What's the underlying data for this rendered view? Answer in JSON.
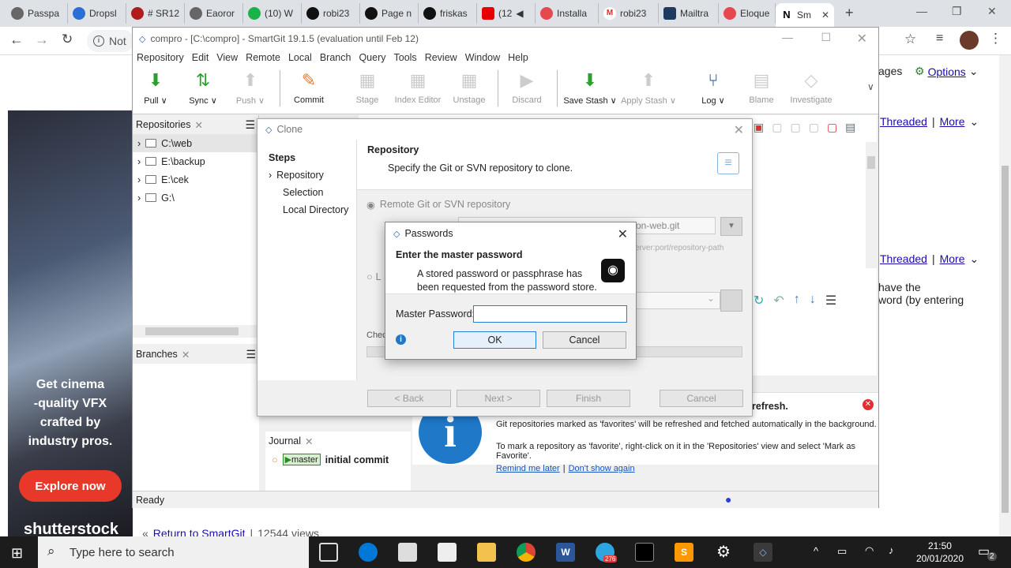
{
  "browser": {
    "tabs": [
      {
        "label": "Passpa",
        "color": "#555"
      },
      {
        "label": "Dropsl",
        "color": "#2a6fd6"
      },
      {
        "label": "# SR12",
        "color": "#b01c1c"
      },
      {
        "label": "Eaoror",
        "color": "#555"
      },
      {
        "label": "(10) W",
        "color": "#19b34a"
      },
      {
        "label": "robi23",
        "color": "#111"
      },
      {
        "label": "Page n",
        "color": "#111"
      },
      {
        "label": "friskas",
        "color": "#111"
      },
      {
        "label": "(12",
        "color": "#e60000"
      },
      {
        "label": "Installa",
        "color": "#e5484d"
      },
      {
        "label": "robi23",
        "color": "#d93025"
      },
      {
        "label": "Mailtra",
        "color": "#1e3a5f"
      },
      {
        "label": "Eloque",
        "color": "#e5484d"
      },
      {
        "label": "Sm",
        "color": "#111",
        "active": true
      }
    ],
    "not_secure": "Not",
    "new_tab": "+"
  },
  "webpage": {
    "ages": "ages",
    "options": "Options",
    "threaded": "Threaded",
    "more": "More",
    "have_the": "have the",
    "word_entering": "word (by entering",
    "ad_text": [
      "Get cinema",
      "-quality VFX",
      "crafted by",
      "industry pros."
    ],
    "explore": "Explore now",
    "shutterstock": "shutterstock",
    "return_link": "Return to SmartGit",
    "views": "12544 views",
    "return_prefix": "«",
    "sep": "|"
  },
  "smartgit": {
    "title": "compro - [C:\\compro] - SmartGit 19.1.5 (evaluation until Feb 12)",
    "menu": [
      "Repository",
      "Edit",
      "View",
      "Remote",
      "Local",
      "Branch",
      "Query",
      "Tools",
      "Review",
      "Window",
      "Help"
    ],
    "tools": [
      {
        "label": "Pull ∨",
        "enabled": true
      },
      {
        "label": "Sync ∨",
        "enabled": true
      },
      {
        "label": "Push ∨",
        "enabled": false
      },
      {
        "label": "Commit",
        "enabled": true
      },
      {
        "label": "Stage",
        "enabled": false
      },
      {
        "label": "Index Editor",
        "enabled": false
      },
      {
        "label": "Unstage",
        "enabled": false
      },
      {
        "label": "Discard",
        "enabled": false
      },
      {
        "label": "Save Stash ∨",
        "enabled": true
      },
      {
        "label": "Apply Stash ∨",
        "enabled": false
      },
      {
        "label": "Log ∨",
        "enabled": true
      },
      {
        "label": "Blame",
        "enabled": false
      },
      {
        "label": "Investigate",
        "enabled": false
      }
    ],
    "repositories_title": "Repositories",
    "repos": [
      "C:\\web",
      "E:\\backup",
      "E:\\cek",
      "G:\\"
    ],
    "branches_title": "Branches",
    "journal_title": "Journal",
    "journal_branch": "master",
    "journal_commit": "initial commit",
    "status": "Ready",
    "info": {
      "heading": "refresh.",
      "line1": "Git repositories marked as 'favorites' will be refreshed and fetched automatically in the background.",
      "line2": "To mark a repository as 'favorite', right-click on it in the 'Repositories' view and select 'Mark as Favorite'.",
      "remind": "Remind me later",
      "dont_show": "Don't show again"
    }
  },
  "clone": {
    "title": "Clone",
    "steps_title": "Steps",
    "steps": [
      "Repository",
      "Selection",
      "Local Directory"
    ],
    "heading": "Repository",
    "desc": "Specify the Git or SVN repository to clone.",
    "remote_option": "Remote Git or SVN repository",
    "url_value": "on-web.git",
    "url_hint": "erver:port/repository-path",
    "local_prefix": "L",
    "check_prefix": "Chec",
    "back": "< Back",
    "next": "Next >",
    "finish": "Finish",
    "cancel": "Cancel"
  },
  "passwords": {
    "title": "Passwords",
    "heading": "Enter the master password",
    "message": "A stored password or passphrase has been requested from the password store.",
    "field_label": "Master Password:",
    "field_value": "",
    "ok": "OK",
    "cancel": "Cancel"
  },
  "taskbar": {
    "search_placeholder": "Type here to search",
    "time": "21:50",
    "date": "20/01/2020",
    "telegram_badge": "276",
    "notif_count": "2"
  }
}
